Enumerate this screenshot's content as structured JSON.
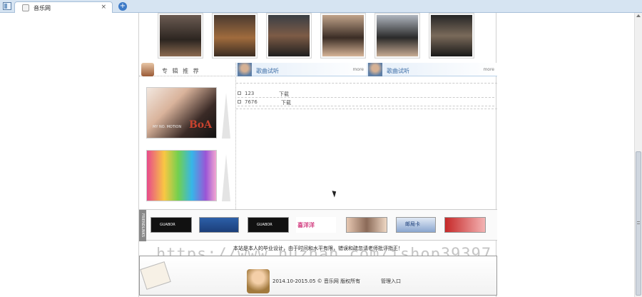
{
  "browser": {
    "tab_title": "音乐网",
    "close_glyph": "×",
    "newtab_glyph": "+"
  },
  "sidebar": {
    "album_title": "专 辑 推 荐",
    "album_cover_text": "BoA",
    "album_cover_sub": "MY NO. MOTION"
  },
  "songs": {
    "left_title": "歌曲试听",
    "right_title": "歌曲试听",
    "more_label": "more",
    "rows": [
      {
        "name": "123",
        "download": "下载"
      },
      {
        "name": "7676",
        "download": "下载"
      }
    ]
  },
  "links": {
    "label": "FRIENDLINKS",
    "items": [
      {
        "icon": "link-banner-1",
        "text": "GUABOR"
      },
      {
        "icon": "link-banner-2",
        "text": ""
      },
      {
        "icon": "link-banner-3",
        "text": "GUABOR"
      },
      {
        "icon": "link-banner-4",
        "text": "喜洋洋"
      },
      {
        "icon": "link-banner-5",
        "text": ""
      },
      {
        "icon": "link-banner-6",
        "text": "邮局卡"
      },
      {
        "icon": "link-banner-7",
        "text": ""
      }
    ]
  },
  "notice": "本站是本人的毕业设计，由于时间和水平有限，错误和疏忽请老师批评指正！",
  "watermark": "https://www.huzhan.com/ishop39397",
  "footer": {
    "copyright": "2014.10-2015.05 © 音乐网 版权所有",
    "admin_link": "管理入口"
  },
  "colors": {
    "accent": "#3d6ea7",
    "tabbar": "#d6e4f2"
  }
}
